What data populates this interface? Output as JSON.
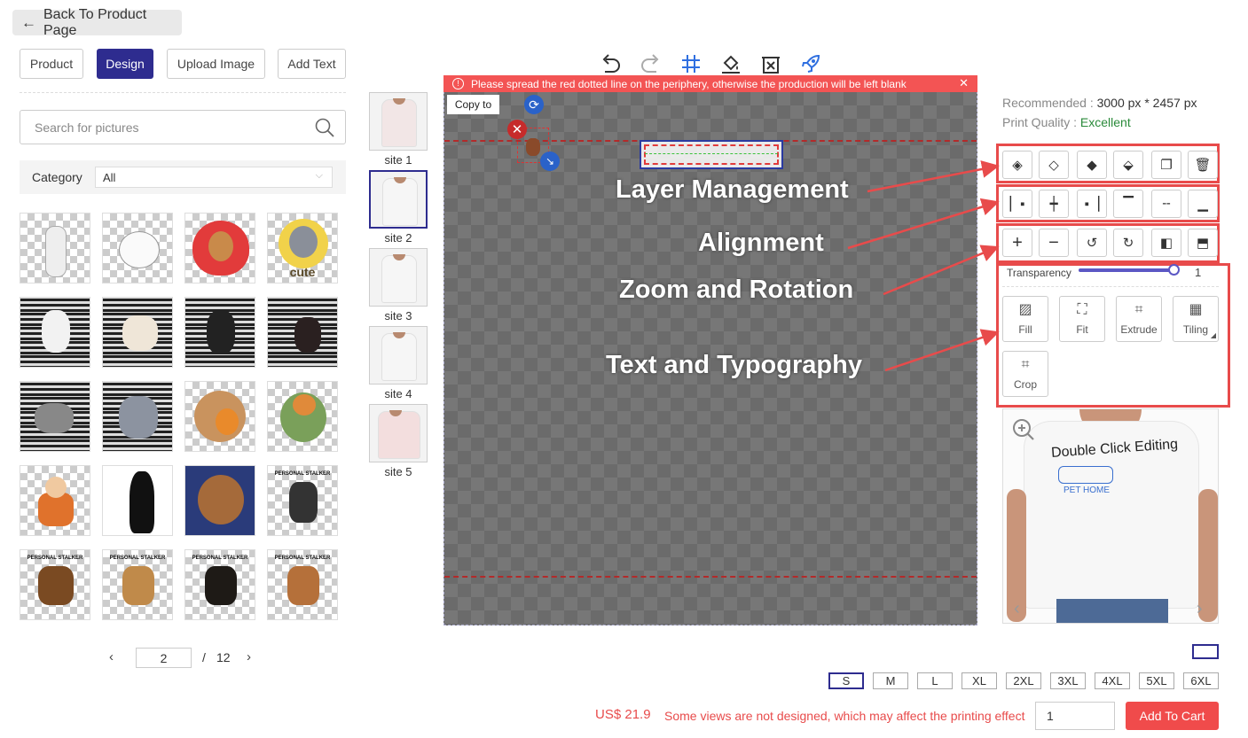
{
  "back_label": "Back To Product Page",
  "tabs": [
    "Product",
    "Design",
    "Upload Image",
    "Add Text"
  ],
  "active_tab": "Design",
  "search": {
    "placeholder": "Search for pictures"
  },
  "category": {
    "label": "Category",
    "selected": "All"
  },
  "gallery_labels": [
    "PERSONAL STALKER",
    "PERSONAL STALKER",
    "PERSONAL STALKER",
    "PERSONAL STALKER",
    "PERSONAL STALKER"
  ],
  "pagination": {
    "current": "2",
    "separator": "/",
    "total": "12"
  },
  "sites": [
    "site 1",
    "site 2",
    "site 3",
    "site 4",
    "site 5"
  ],
  "selected_site": "site 2",
  "warning": "Please spread the red dotted line on the periphery, otherwise the production will be left blank",
  "copy_to": "Copy to",
  "annotations": {
    "layer": "Layer Management",
    "alignment": "Alignment",
    "zoom": "Zoom and Rotation",
    "text": "Text and Typography"
  },
  "info": {
    "recommended_label": "Recommended : ",
    "recommended_value": "3000 px * 2457 px",
    "quality_label": "Print Quality : ",
    "quality_value": "Excellent"
  },
  "transparency": {
    "label": "Transparency",
    "value": "1",
    "level": 1.0
  },
  "tools": [
    "Fill",
    "Fit",
    "Extrude",
    "Tiling",
    "Crop"
  ],
  "preview_text": {
    "line1": "Double Click Editing",
    "line2": "PET HOME"
  },
  "sizes": [
    "S",
    "M",
    "L",
    "XL",
    "2XL",
    "3XL",
    "4XL",
    "5XL",
    "6XL"
  ],
  "selected_size": "S",
  "footer": {
    "price": "US$ 21.9",
    "notice": "Some views are not designed, which may affect the printing effect",
    "quantity": "1",
    "add_to_cart": "Add To Cart"
  },
  "colors": {
    "accent": "#2e2c8f",
    "danger": "#f35454",
    "quality": "#2a8a3a"
  }
}
